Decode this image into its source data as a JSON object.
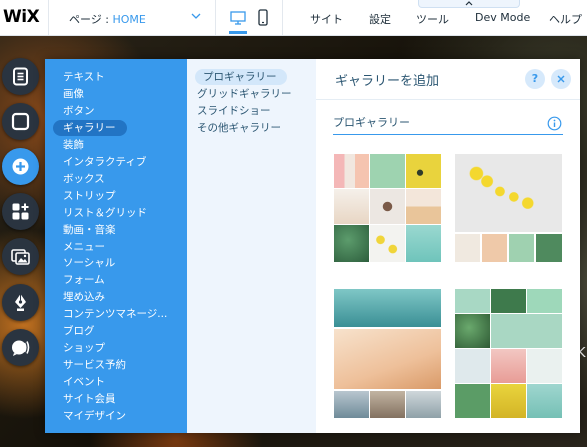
{
  "topbar": {
    "logo": "WiX",
    "page_label": "ページ : ",
    "page_value": "HOME",
    "menu": {
      "site": "サイト",
      "settings": "設定",
      "tools": "ツール",
      "devmode": "Dev Mode",
      "help": "ヘルプ"
    }
  },
  "tools": [
    "pages-icon",
    "background-icon",
    "add-icon",
    "add-apps-icon",
    "media-icon",
    "blog-icon",
    "comments-icon"
  ],
  "categories": [
    "テキスト",
    "画像",
    "ボタン",
    "ギャラリー",
    "装飾",
    "インタラクティブ",
    "ボックス",
    "ストリップ",
    "リスト＆グリッド",
    "動画・音楽",
    "メニュー",
    "ソーシャル",
    "フォーム",
    "埋め込み",
    "コンテンツマネージ...",
    "ブログ",
    "ショップ",
    "サービス予約",
    "イベント",
    "サイト会員",
    "マイデザイン"
  ],
  "selected_category": "ギャラリー",
  "subcategories": [
    "プロギャラリー",
    "グリッドギャラリー",
    "スライドショー",
    "その他ギャラリー"
  ],
  "selected_subcategory": "プロギャラリー",
  "panel": {
    "title": "ギャラリーを追加",
    "help": "?",
    "section_title": "プロギャラリー"
  },
  "colors": {
    "accent": "#3899ec",
    "category_bg": "#3899ec",
    "category_selected": "#2274c4",
    "sub_bg": "#eef5fd"
  },
  "background_text": "K"
}
